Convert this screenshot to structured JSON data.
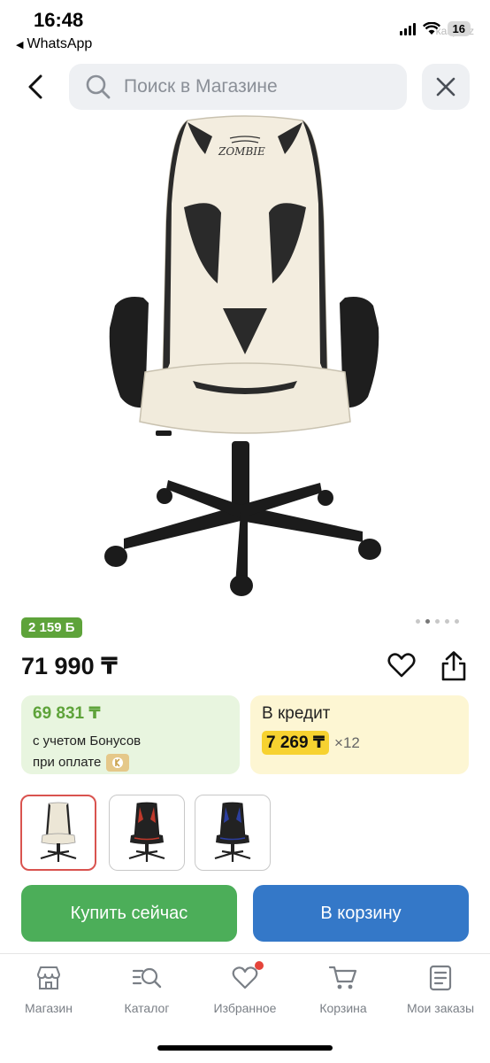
{
  "status_bar": {
    "time": "16:48",
    "back_app": "WhatsApp",
    "watermark": "kaspi.kz",
    "battery": "16"
  },
  "header": {
    "search_placeholder": "Поиск в Магазине",
    "icons": [
      "back-chevron-icon",
      "search-icon",
      "close-icon"
    ]
  },
  "product": {
    "logo_text": "ZOMBIE",
    "bonus_badge": "2 159 Б",
    "price": "71 990 ₸",
    "gallery_total": 5,
    "gallery_active_index": 1
  },
  "bonus_card": {
    "amount": "69 831 ₸",
    "line1": "с учетом Бонусов",
    "line2": "при оплате"
  },
  "credit_card": {
    "title": "В кредит",
    "monthly": "7 269 ₸",
    "term": "×12"
  },
  "variants": [
    {
      "color": "white",
      "accent": "#e9e4d6",
      "selected": true
    },
    {
      "color": "red",
      "accent": "#c0392b",
      "selected": false
    },
    {
      "color": "blue",
      "accent": "#2c3e9e",
      "selected": false
    }
  ],
  "actions": {
    "buy_now": "Купить сейчас",
    "add_to_cart": "В корзину"
  },
  "tab_bar": {
    "items": [
      {
        "label": "Магазин",
        "icon": "store-icon"
      },
      {
        "label": "Каталог",
        "icon": "catalog-search-icon"
      },
      {
        "label": "Избранное",
        "icon": "heart-icon",
        "has_badge": true
      },
      {
        "label": "Корзина",
        "icon": "cart-icon"
      },
      {
        "label": "Мои заказы",
        "icon": "orders-icon"
      }
    ]
  },
  "colors": {
    "green": "#4cae59",
    "blue": "#3478c8",
    "bonus_green": "#5ea33a",
    "credit_yellow": "#f7d230",
    "selected_border": "#d9534f"
  }
}
